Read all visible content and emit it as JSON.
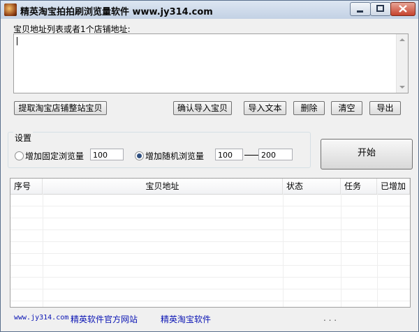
{
  "window": {
    "title": "精英淘宝拍拍刷浏览量软件 www.jy314.com"
  },
  "input_section": {
    "label": "宝贝地址列表或者1个店铺地址:"
  },
  "buttons": {
    "fetch_store": "提取淘宝店铺整站宝贝",
    "confirm_import": "确认导入宝贝",
    "import_text": "导入文本",
    "delete": "删除",
    "clear": "清空",
    "export": "导出",
    "start": "开始"
  },
  "settings": {
    "label": "设置",
    "fixed_option": "增加固定浏览量",
    "fixed_value": "100",
    "random_option": "增加随机浏览量",
    "random_min": "100",
    "random_max": "200",
    "selected": "random"
  },
  "table": {
    "columns": [
      "序号",
      "宝贝地址",
      "状态",
      "任务",
      "已增加"
    ]
  },
  "footer": {
    "url": "www.jy314.com",
    "site_link": "精英软件官方网站",
    "taobao_link": "精英淘宝软件",
    "status": ". . ."
  },
  "colors": {
    "link": "#0a14b4",
    "titlebar": "#c3d1e4"
  }
}
